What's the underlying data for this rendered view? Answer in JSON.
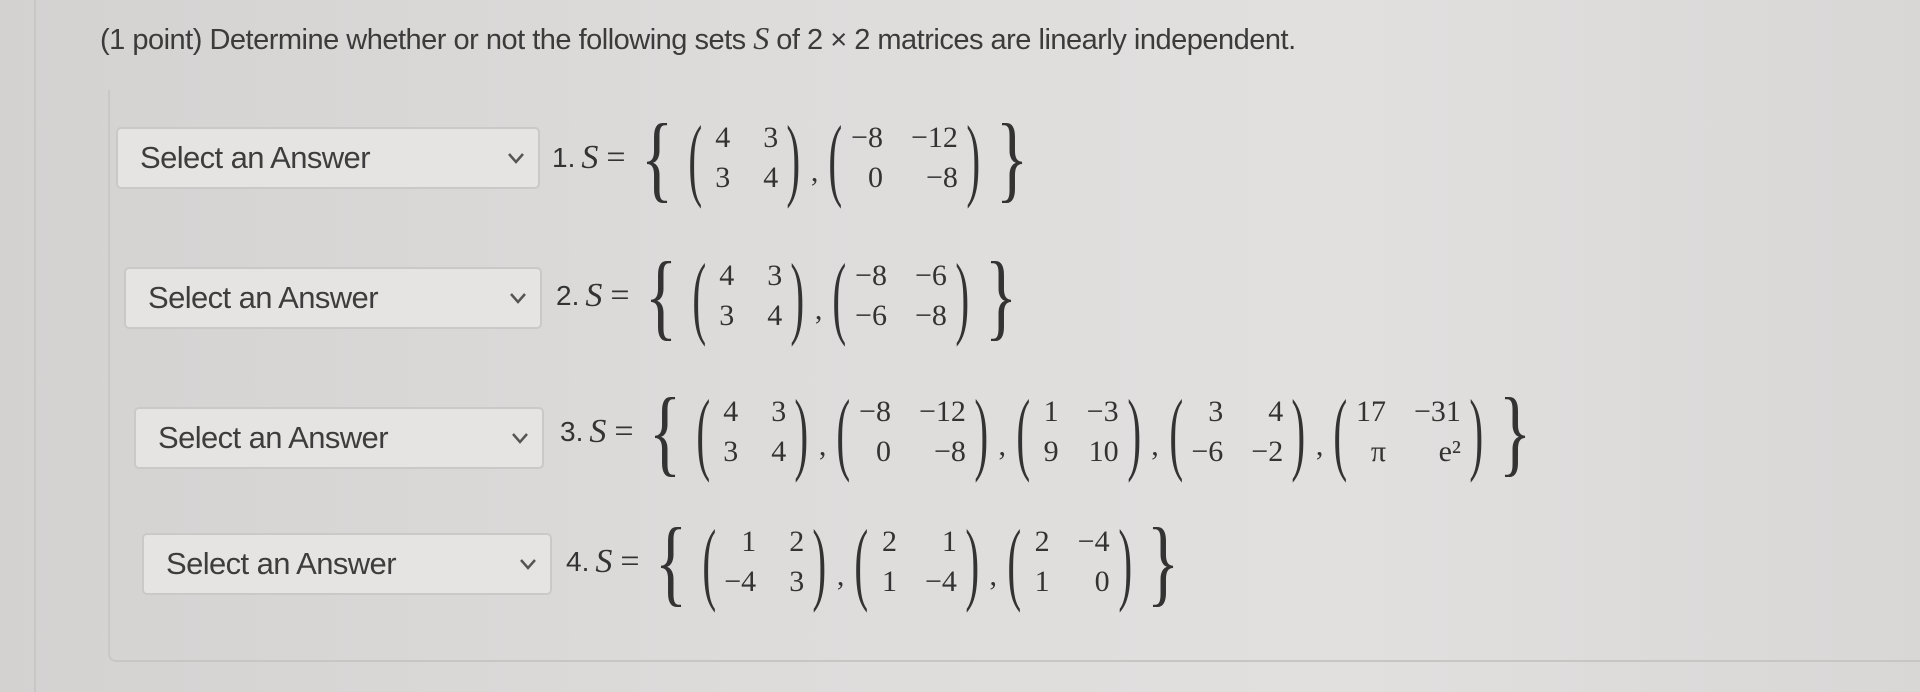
{
  "prompt": {
    "prefix": "(1 point) Determine whether or not the following sets ",
    "set_var": "S",
    "middle": " of 2 × 2 matrices are linearly independent."
  },
  "questions": [
    {
      "number": "1.",
      "select_value": "Select an Answer",
      "matrices": [
        [
          [
            "4",
            "3"
          ],
          [
            "3",
            "4"
          ]
        ],
        [
          [
            "−8",
            "−12"
          ],
          [
            "0",
            "−8"
          ]
        ]
      ]
    },
    {
      "number": "2.",
      "select_value": "Select an Answer",
      "matrices": [
        [
          [
            "4",
            "3"
          ],
          [
            "3",
            "4"
          ]
        ],
        [
          [
            "−8",
            "−6"
          ],
          [
            "−6",
            "−8"
          ]
        ]
      ]
    },
    {
      "number": "3.",
      "select_value": "Select an Answer",
      "matrices": [
        [
          [
            "4",
            "3"
          ],
          [
            "3",
            "4"
          ]
        ],
        [
          [
            "−8",
            "−12"
          ],
          [
            "0",
            "−8"
          ]
        ],
        [
          [
            "1",
            "−3"
          ],
          [
            "9",
            "10"
          ]
        ],
        [
          [
            "3",
            "4"
          ],
          [
            "−6",
            "−2"
          ]
        ],
        [
          [
            "17",
            "−31"
          ],
          [
            "π",
            "e²"
          ]
        ]
      ]
    },
    {
      "number": "4.",
      "select_value": "Select an Answer",
      "matrices": [
        [
          [
            "1",
            "2"
          ],
          [
            "−4",
            "3"
          ]
        ],
        [
          [
            "2",
            "1"
          ],
          [
            "1",
            "−4"
          ]
        ],
        [
          [
            "2",
            "−4"
          ],
          [
            "1",
            "0"
          ]
        ]
      ]
    }
  ],
  "math": {
    "set_var": "S",
    "equals": "=",
    "open_brace": "{",
    "close_brace": "}",
    "open_paren": "(",
    "close_paren": ")",
    "separator": ","
  },
  "colors": {
    "background": "#d8d6d5",
    "text": "#3a3a3a",
    "select_bg": "#e6e4e3",
    "select_border": "#cbc9c8"
  }
}
